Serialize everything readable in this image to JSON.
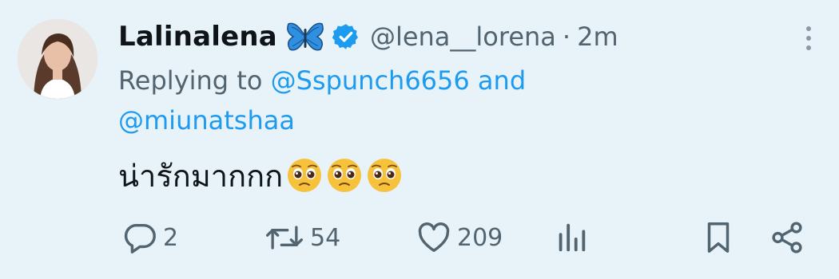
{
  "author": {
    "display_name": "Lalinalena",
    "handle": "@lena__lorena",
    "separator": "·",
    "time_ago": "2m",
    "verified": true
  },
  "reply": {
    "prefix": "Replying to",
    "first_user": "@Sspunch6656",
    "conjunction": "and",
    "second_user": "@miunatshaa"
  },
  "tweet": {
    "text": "น่ารักมากกก",
    "emoji": [
      "pleading-face",
      "pleading-face",
      "pleading-face"
    ]
  },
  "actions": {
    "replies": "2",
    "retweets": "54",
    "likes": "209"
  },
  "colors": {
    "background": "#e7f3f8",
    "link": "#1d9bf0",
    "muted": "#536471",
    "verified": "#1d9bf0"
  }
}
